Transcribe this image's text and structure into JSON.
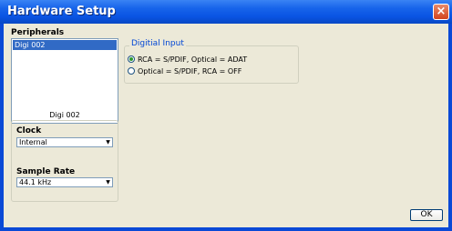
{
  "window": {
    "title": "Hardware Setup"
  },
  "peripherals": {
    "title": "Peripherals",
    "items": [
      "Digi 002"
    ],
    "selected_label": "Digi 002"
  },
  "clock": {
    "label": "Clock",
    "value": "Internal"
  },
  "sample_rate": {
    "label": "Sample Rate",
    "value": "44.1 kHz"
  },
  "digital_input": {
    "title": "Digitial Input",
    "options": [
      {
        "label": "RCA = S/PDIF, Optical = ADAT",
        "selected": true
      },
      {
        "label": "Optical = S/PDIF, RCA = OFF",
        "selected": false
      }
    ]
  },
  "buttons": {
    "ok": "OK"
  },
  "colors": {
    "titlebar": "#0a54e3",
    "selection": "#316ac5",
    "group_title": "#0046d5"
  }
}
